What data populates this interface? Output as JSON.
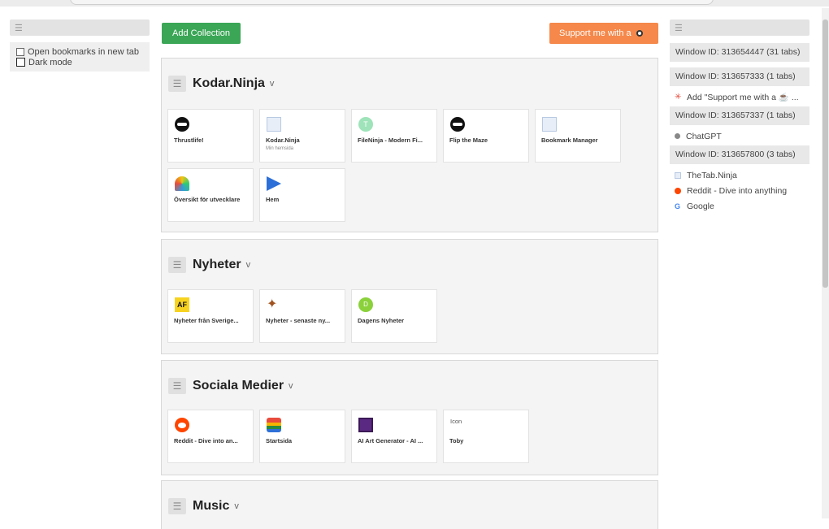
{
  "left_sidebar": {
    "settings": [
      {
        "label": "Open bookmarks in new tab",
        "checked": false
      },
      {
        "label": "Dark mode",
        "checked": false
      }
    ]
  },
  "toolbar": {
    "add_label": "Add Collection",
    "support_label": "Support me with a"
  },
  "collections": [
    {
      "title": "Kodar.Ninja",
      "cards": [
        {
          "title": "Thrustlife!",
          "icon": "ninja-icon"
        },
        {
          "title": "Kodar.Ninja",
          "subtitle": "Min hemsida",
          "icon": "document-icon"
        },
        {
          "title": "FileNinja - Modern Fi...",
          "icon": "fileninja-icon"
        },
        {
          "title": "Flip the Maze",
          "icon": "ninja-icon"
        },
        {
          "title": "Bookmark Manager",
          "icon": "document-icon"
        },
        {
          "title": "Översikt för utvecklare",
          "icon": "rainbow-icon"
        },
        {
          "title": "Hem",
          "icon": "play-icon"
        }
      ]
    },
    {
      "title": "Nyheter",
      "cards": [
        {
          "title": "Nyheter från Sverige...",
          "icon": "aftonbladet-icon",
          "icon_text": "AF"
        },
        {
          "title": "Nyheter - senaste ny...",
          "icon": "bird-icon"
        },
        {
          "title": "Dagens Nyheter",
          "icon": "dn-icon",
          "icon_text": "D"
        }
      ]
    },
    {
      "title": "Sociala Medier",
      "cards": [
        {
          "title": "Reddit - Dive into an...",
          "icon": "reddit-icon"
        },
        {
          "title": "Startsida",
          "icon": "wallet-icon"
        },
        {
          "title": "AI Art Generator - AI ...",
          "icon": "ai-art-icon"
        },
        {
          "title": "Toby",
          "icon": "broken-image-icon",
          "icon_text": "Icon"
        }
      ]
    },
    {
      "title": "Music",
      "cards": []
    }
  ],
  "right_sidebar": {
    "windows": [
      {
        "label": "Window ID: 313654447 (31 tabs)",
        "tabs": [
          {
            "title": "Add \"Support me with a ☕ ...",
            "icon": "bug-icon"
          }
        ]
      },
      {
        "label": "Window ID: 313657333 (1 tabs)",
        "tabs": []
      },
      {
        "label": "Window ID: 313657337 (1 tabs)",
        "tabs": [
          {
            "title": "ChatGPT",
            "icon": "chatgpt-icon"
          }
        ]
      },
      {
        "label": "Window ID: 313657800 (3 tabs)",
        "tabs": [
          {
            "title": "TheTab.Ninja",
            "icon": "document-icon"
          },
          {
            "title": "Reddit - Dive into anything",
            "icon": "reddit-icon"
          },
          {
            "title": "Google",
            "icon": "google-icon"
          }
        ]
      }
    ]
  }
}
